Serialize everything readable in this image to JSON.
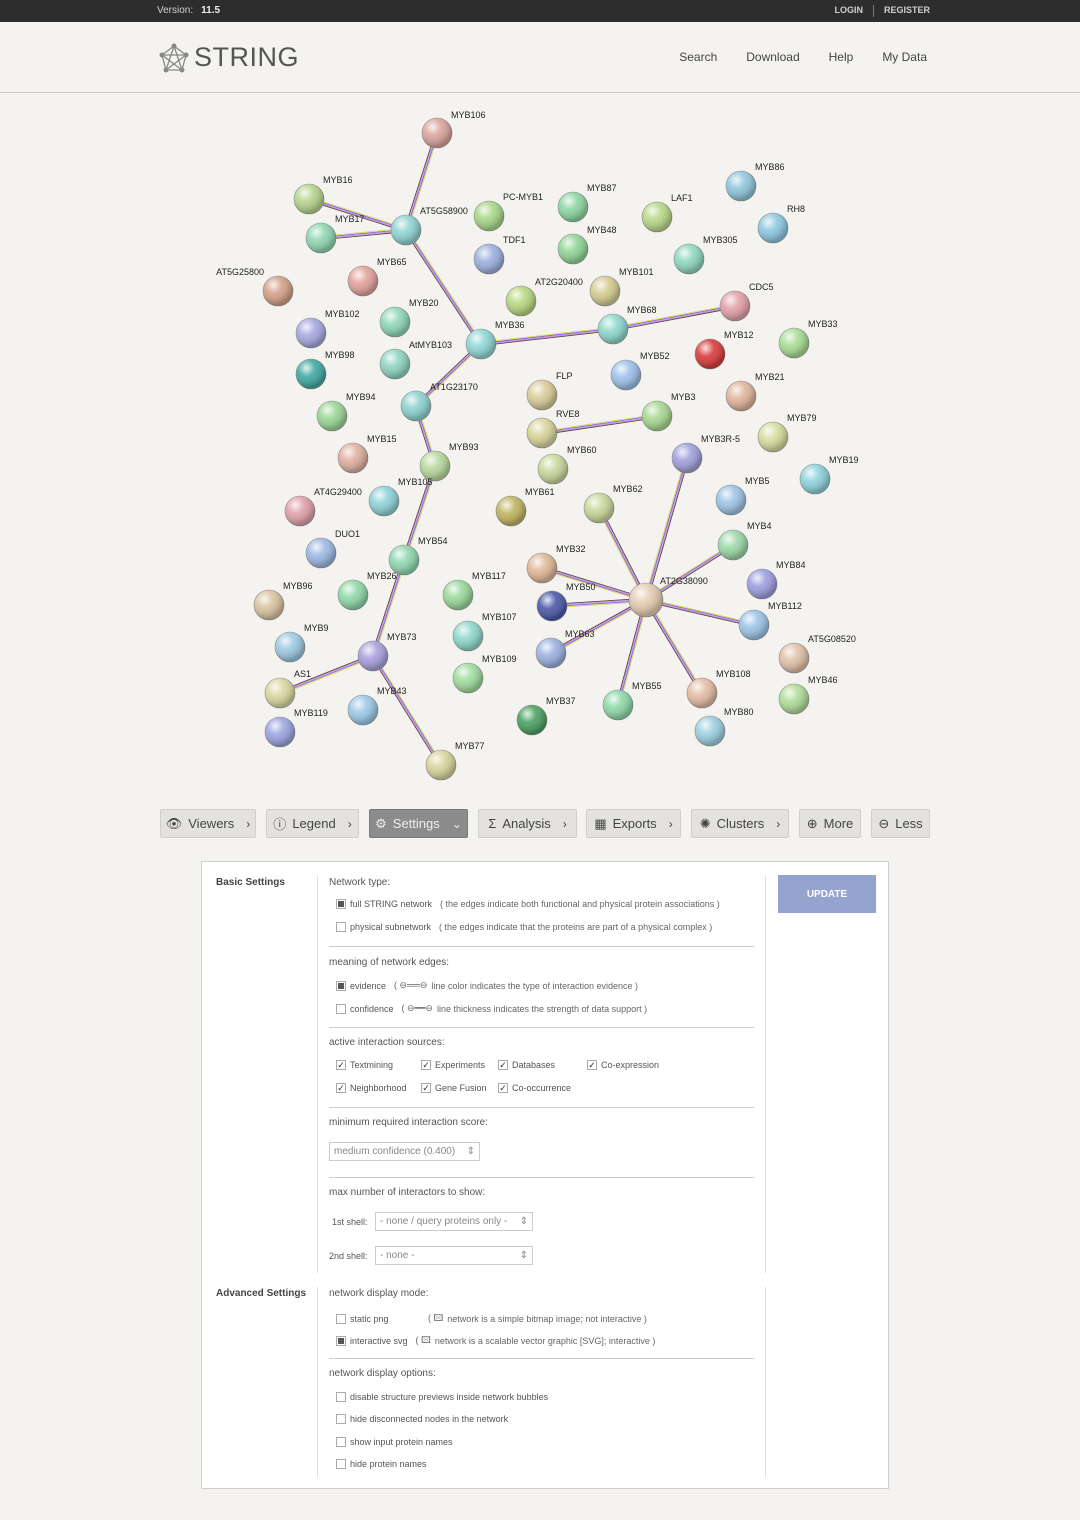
{
  "topbar": {
    "version_label": "Version:",
    "version_value": "11.5",
    "login": "LOGIN",
    "register": "REGISTER"
  },
  "header": {
    "logo_text": "STRING",
    "nav": [
      "Search",
      "Download",
      "Help",
      "My Data"
    ]
  },
  "network": {
    "nodes": [
      {
        "id": "MYB106",
        "color": "#d9a49c"
      },
      {
        "id": "MYB16",
        "color": "#b5d48c"
      },
      {
        "id": "MYB17",
        "color": "#8fd6b0"
      },
      {
        "id": "AT5G58900",
        "color": "#8ed4d2"
      },
      {
        "id": "PC-MYB1",
        "color": "#a6d888"
      },
      {
        "id": "MYB87",
        "color": "#8cd6a0"
      },
      {
        "id": "LAF1",
        "color": "#b8d888"
      },
      {
        "id": "MYB86",
        "color": "#8fc6dc"
      },
      {
        "id": "RH8",
        "color": "#8cc8e0"
      },
      {
        "id": "TDF1",
        "color": "#9cb0e0"
      },
      {
        "id": "MYB48",
        "color": "#8fd694"
      },
      {
        "id": "MYB305",
        "color": "#8ed8c0"
      },
      {
        "id": "AT5G25800",
        "color": "#d4a088"
      },
      {
        "id": "MYB65",
        "color": "#e4a29c"
      },
      {
        "id": "AT2G20400",
        "color": "#b8d880"
      },
      {
        "id": "MYB101",
        "color": "#d4cc90"
      },
      {
        "id": "CDC5",
        "color": "#e4a0a8"
      },
      {
        "id": "MYB102",
        "color": "#a6a8e0"
      },
      {
        "id": "MYB20",
        "color": "#8ed8b8"
      },
      {
        "id": "MYB36",
        "color": "#8ed6d4"
      },
      {
        "id": "MYB68",
        "color": "#8ed8cc"
      },
      {
        "id": "MYB33",
        "color": "#a8dc94"
      },
      {
        "id": "MYB98",
        "color": "#3fa8a0"
      },
      {
        "id": "AtMYB103",
        "color": "#8ed4c0"
      },
      {
        "id": "MYB12",
        "color": "#d83a3a"
      },
      {
        "id": "MYB52",
        "color": "#9cc0e8"
      },
      {
        "id": "FLP",
        "color": "#d8cc98"
      },
      {
        "id": "MYB21",
        "color": "#e0b49c"
      },
      {
        "id": "MYB94",
        "color": "#9ad694"
      },
      {
        "id": "AT1G23170",
        "color": "#8cd2d0"
      },
      {
        "id": "RVE8",
        "color": "#d8d49c"
      },
      {
        "id": "MYB3",
        "color": "#a8d890"
      },
      {
        "id": "MYB79",
        "color": "#d4dc9c"
      },
      {
        "id": "MYB15",
        "color": "#e0b0a0"
      },
      {
        "id": "MYB93",
        "color": "#b8d89c"
      },
      {
        "id": "MYB60",
        "color": "#c8d89c"
      },
      {
        "id": "MYB3R-5",
        "color": "#a0a0dc"
      },
      {
        "id": "MYB19",
        "color": "#8ed2dc"
      },
      {
        "id": "AT4G29400",
        "color": "#e0a0a8"
      },
      {
        "id": "MYB105",
        "color": "#8ed2d8"
      },
      {
        "id": "MYB61",
        "color": "#c0b460"
      },
      {
        "id": "MYB62",
        "color": "#c8d89c"
      },
      {
        "id": "MYB5",
        "color": "#9cc4e4"
      },
      {
        "id": "DUO1",
        "color": "#9cb8e4"
      },
      {
        "id": "MYB54",
        "color": "#8ed8b0"
      },
      {
        "id": "MYB4",
        "color": "#9cd8a8"
      },
      {
        "id": "MYB32",
        "color": "#e0b898"
      },
      {
        "id": "MYB84",
        "color": "#9c9ce0"
      },
      {
        "id": "MYB96",
        "color": "#d8c4a0"
      },
      {
        "id": "MYB26",
        "color": "#8fd8a8"
      },
      {
        "id": "MYB117",
        "color": "#9ad89c"
      },
      {
        "id": "MYB50",
        "color": "#4a58a8"
      },
      {
        "id": "AT2G38090",
        "color": "#e4ccb0"
      },
      {
        "id": "MYB112",
        "color": "#9cc4e8"
      },
      {
        "id": "MYB9",
        "color": "#9cc8e0"
      },
      {
        "id": "MYB107",
        "color": "#8ed8cc"
      },
      {
        "id": "AT5G08520",
        "color": "#e0c0a8"
      },
      {
        "id": "MYB73",
        "color": "#a8a0dc"
      },
      {
        "id": "MYB63",
        "color": "#9cb0e0"
      },
      {
        "id": "AS1",
        "color": "#d8d8a0"
      },
      {
        "id": "MYB109",
        "color": "#a0dc9c"
      },
      {
        "id": "MYB108",
        "color": "#e4bca4"
      },
      {
        "id": "MYB46",
        "color": "#b0dc98"
      },
      {
        "id": "MYB43",
        "color": "#9cc8e8"
      },
      {
        "id": "MYB55",
        "color": "#8ed8a8"
      },
      {
        "id": "MYB119",
        "color": "#9ca4e0"
      },
      {
        "id": "MYB37",
        "color": "#4aa060"
      },
      {
        "id": "MYB80",
        "color": "#9cd0e0"
      },
      {
        "id": "MYB77",
        "color": "#d8d49c"
      }
    ],
    "edges": [
      [
        "MYB106",
        "AT5G58900"
      ],
      [
        "MYB16",
        "AT5G58900"
      ],
      [
        "MYB17",
        "AT5G58900"
      ],
      [
        "AT5G58900",
        "MYB36"
      ],
      [
        "MYB36",
        "MYB68"
      ],
      [
        "MYB68",
        "CDC5"
      ],
      [
        "MYB36",
        "AT1G23170"
      ],
      [
        "AT1G23170",
        "MYB93"
      ],
      [
        "MYB93",
        "MYB54"
      ],
      [
        "MYB54",
        "MYB73"
      ],
      [
        "MYB73",
        "AS1"
      ],
      [
        "MYB73",
        "MYB77"
      ],
      [
        "RVE8",
        "MYB3"
      ],
      [
        "AT2G38090",
        "MYB3R-5"
      ],
      [
        "AT2G38090",
        "MYB62"
      ],
      [
        "AT2G38090",
        "MYB4"
      ],
      [
        "AT2G38090",
        "MYB32"
      ],
      [
        "AT2G38090",
        "MYB112"
      ],
      [
        "AT2G38090",
        "MYB63"
      ],
      [
        "AT2G38090",
        "MYB55"
      ],
      [
        "AT2G38090",
        "MYB108"
      ],
      [
        "AT2G38090",
        "MYB50"
      ]
    ]
  },
  "toolbar": {
    "buttons": [
      {
        "label": "Viewers",
        "icon": "eye-icon"
      },
      {
        "label": "Legend",
        "icon": "info-icon"
      },
      {
        "label": "Settings",
        "icon": "gear-icon"
      },
      {
        "label": "Analysis",
        "icon": "sigma-icon"
      },
      {
        "label": "Exports",
        "icon": "table-icon"
      },
      {
        "label": "Clusters",
        "icon": "cluster-icon"
      },
      {
        "label": "More",
        "icon": "plus-icon"
      },
      {
        "label": "Less",
        "icon": "minus-icon"
      }
    ]
  },
  "settings": {
    "basic_title": "Basic Settings",
    "advanced_title": "Advanced Settings",
    "update_label": "UPDATE",
    "network_type": {
      "label": "Network type:",
      "options": [
        {
          "name": "full STRING network",
          "desc": "( the edges indicate both functional and physical protein associations )",
          "checked": true
        },
        {
          "name": "physical subnetwork",
          "desc": "( the edges indicate that the proteins are part of a physical complex )",
          "checked": false
        }
      ]
    },
    "edges_meaning": {
      "label": "meaning of network edges:",
      "options": [
        {
          "name": "evidence",
          "desc": "line color indicates the type of interaction evidence )",
          "checked": true
        },
        {
          "name": "confidence",
          "desc": "line thickness indicates the strength of data support )",
          "checked": false
        }
      ]
    },
    "sources": {
      "label": "active interaction sources:",
      "items": [
        "Textmining",
        "Experiments",
        "Databases",
        "Co-expression",
        "Neighborhood",
        "Gene Fusion",
        "Co-occurrence"
      ]
    },
    "min_score": {
      "label": "minimum required interaction score:",
      "value": "medium confidence (0.400)"
    },
    "max_interactors": {
      "label": "max number of interactors to show:",
      "shell1_label": "1st shell:",
      "shell1_value": "- none / query proteins only -",
      "shell2_label": "2nd shell:",
      "shell2_value": "- none -"
    },
    "display_mode": {
      "label": "network display mode:",
      "options": [
        {
          "name": "static png",
          "desc": "network is a simple bitmap image; not interactive )",
          "checked": false
        },
        {
          "name": "interactive svg",
          "desc": "network is a scalable vector graphic [SVG]; interactive )",
          "checked": true
        }
      ]
    },
    "display_options": {
      "label": "network display options:",
      "items": [
        "disable structure previews inside network bubbles",
        "hide disconnected nodes in the network",
        "show input protein names",
        "hide protein names"
      ]
    }
  }
}
